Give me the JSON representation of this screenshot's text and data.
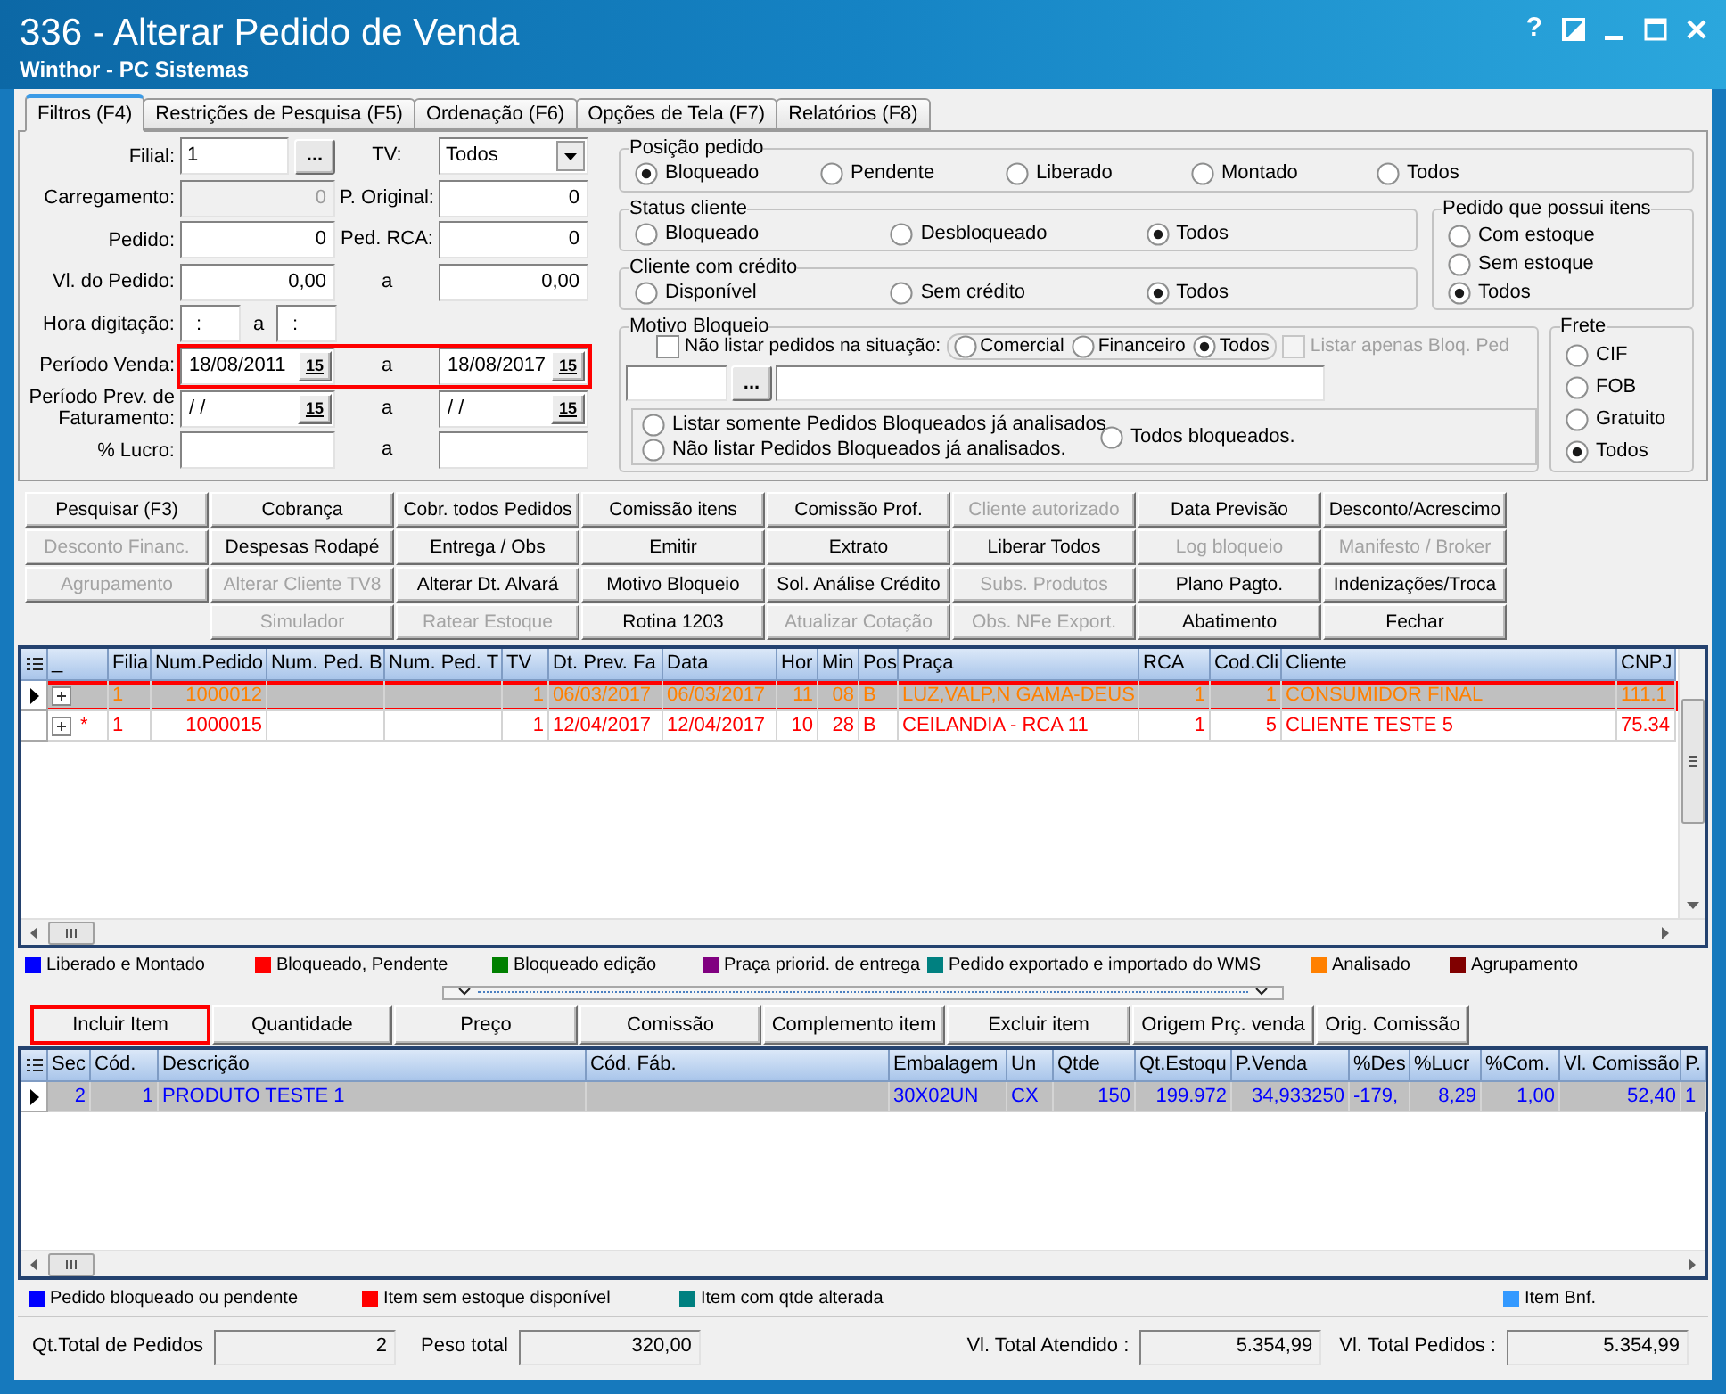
{
  "window": {
    "title": "336 - Alterar Pedido de Venda",
    "subtitle": "Winthor - PC Sistemas",
    "help": "?"
  },
  "tabs": [
    {
      "label": "Filtros (F4)",
      "selected": true
    },
    {
      "label": "Restrições de Pesquisa (F5)",
      "selected": false
    },
    {
      "label": "Ordenação (F6)",
      "selected": false
    },
    {
      "label": "Opções de Tela (F7)",
      "selected": false
    },
    {
      "label": "Relatórios (F8)",
      "selected": false
    }
  ],
  "filters": {
    "rows": [
      {
        "highlighted": false,
        "left": {
          "label": "Filial:",
          "kind": "browse",
          "value": "1",
          "button": "...",
          "disabled": false
        },
        "right": {
          "label": "TV:",
          "kind": "select",
          "value": "Todos",
          "disabled": false
        }
      },
      {
        "highlighted": false,
        "left": {
          "label": "Carregamento:",
          "kind": "number",
          "value": "0",
          "disabled": true
        },
        "right": {
          "label": "P. Original:",
          "kind": "number",
          "value": "0",
          "disabled": false
        }
      },
      {
        "highlighted": false,
        "left": {
          "label": "Pedido:",
          "kind": "number",
          "value": "0",
          "disabled": false
        },
        "right": {
          "label": "Ped. RCA:",
          "kind": "number",
          "value": "0",
          "disabled": false
        }
      },
      {
        "highlighted": false,
        "left": {
          "label": "Vl. do Pedido:",
          "kind": "number",
          "value": "0,00",
          "disabled": false
        },
        "right": {
          "label": "a",
          "kind": "number",
          "value": "0,00",
          "disabled": false
        }
      },
      {
        "highlighted": false,
        "left": {
          "label": "Hora digitação:",
          "kind": "time",
          "value": ":",
          "disabled": false
        },
        "right": {
          "label": "a",
          "kind": "time",
          "value": ":",
          "disabled": false
        }
      },
      {
        "highlighted": true,
        "left": {
          "label": "Período Venda:",
          "kind": "date",
          "value": "18/08/2011",
          "calendar": "15",
          "disabled": false
        },
        "right": {
          "label": "a",
          "kind": "date",
          "value": "18/08/2017",
          "calendar": "15",
          "disabled": false
        }
      },
      {
        "highlighted": false,
        "left": {
          "label": "Período Prev. de Faturamento:",
          "kind": "date",
          "value": "/ /",
          "calendar": "15",
          "disabled": false
        },
        "right": {
          "label": "a",
          "kind": "date",
          "value": "/ /",
          "calendar": "15",
          "disabled": false
        }
      },
      {
        "highlighted": false,
        "left": {
          "label": "% Lucro:",
          "kind": "number",
          "disabled": false
        },
        "right": {
          "label": "a",
          "kind": "number",
          "disabled": false
        }
      }
    ]
  },
  "position_group": {
    "title": "Posição pedido",
    "options": [
      {
        "label": "Bloqueado",
        "selected": true
      },
      {
        "label": "Pendente",
        "selected": false
      },
      {
        "label": "Liberado",
        "selected": false
      },
      {
        "label": "Montado",
        "selected": false
      },
      {
        "label": "Todos",
        "selected": false
      }
    ]
  },
  "client_status": {
    "title": "Status cliente",
    "options": [
      {
        "label": "Bloqueado",
        "selected": false
      },
      {
        "label": "Desbloqueado",
        "selected": false
      },
      {
        "label": "Todos",
        "selected": true
      }
    ]
  },
  "client_credit": {
    "title": "Cliente com crédito",
    "options": [
      {
        "label": "Disponível",
        "selected": false
      },
      {
        "label": "Sem crédito",
        "selected": false
      },
      {
        "label": "Todos",
        "selected": true
      }
    ]
  },
  "stock_items": {
    "title": "Pedido que possui itens",
    "options": [
      {
        "label": "Com estoque",
        "selected": false
      },
      {
        "label": "Sem estoque",
        "selected": false
      },
      {
        "label": "Todos",
        "selected": true
      }
    ]
  },
  "block_reason": {
    "title": "Motivo Bloqueio",
    "exclude_check": {
      "label": "Não listar pedidos na situação:",
      "checked": false,
      "disabled": false
    },
    "situations": [
      {
        "label": "Comercial",
        "selected": false
      },
      {
        "label": "Financeiro",
        "selected": false
      },
      {
        "label": "Todos",
        "selected": true
      }
    ],
    "only_blocked_check": {
      "label": "Listar apenas Bloq. Ped",
      "checked": false,
      "disabled": true
    },
    "code_button": "...",
    "analysis": [
      {
        "label": "Listar somente Pedidos Bloqueados já analisados.",
        "selected": false
      },
      {
        "label": "Não listar Pedidos Bloqueados já analisados.",
        "selected": false
      },
      {
        "label": "Todos bloqueados.",
        "selected": false
      }
    ]
  },
  "freight": {
    "title": "Frete",
    "options": [
      {
        "label": "CIF",
        "selected": false
      },
      {
        "label": "FOB",
        "selected": false
      },
      {
        "label": "Gratuito",
        "selected": false
      },
      {
        "label": "Todos",
        "selected": true
      }
    ]
  },
  "action_buttons": [
    [
      {
        "label": "Pesquisar (F3)",
        "disabled": false
      },
      {
        "label": "Desconto Financ.",
        "disabled": true
      },
      {
        "label": "Agrupamento",
        "disabled": true
      }
    ],
    [
      {
        "label": "Cobrança",
        "disabled": false
      },
      {
        "label": "Despesas Rodapé",
        "disabled": false
      },
      {
        "label": "Alterar Cliente TV8",
        "disabled": true
      },
      {
        "label": "Simulador",
        "disabled": true
      }
    ],
    [
      {
        "label": "Cobr. todos Pedidos",
        "disabled": false
      },
      {
        "label": "Entrega / Obs",
        "disabled": false
      },
      {
        "label": "Alterar Dt. Alvará",
        "disabled": false
      },
      {
        "label": "Ratear Estoque",
        "disabled": true
      }
    ],
    [
      {
        "label": "Comissão itens",
        "disabled": false
      },
      {
        "label": "Emitir",
        "disabled": false
      },
      {
        "label": "Motivo Bloqueio",
        "disabled": false
      },
      {
        "label": "Rotina 1203",
        "disabled": false
      }
    ],
    [
      {
        "label": "Comissão Prof.",
        "disabled": false
      },
      {
        "label": "Extrato",
        "disabled": false
      },
      {
        "label": "Sol. Análise Crédito",
        "disabled": false
      },
      {
        "label": "Atualizar Cotação",
        "disabled": true
      }
    ],
    [
      {
        "label": "Cliente autorizado",
        "disabled": true
      },
      {
        "label": "Liberar Todos",
        "disabled": false
      },
      {
        "label": "Subs. Produtos",
        "disabled": true
      },
      {
        "label": "Obs. NFe Export.",
        "disabled": true
      }
    ],
    [
      {
        "label": "Data Previsão",
        "disabled": false
      },
      {
        "label": "Log bloqueio",
        "disabled": true
      },
      {
        "label": "Plano Pagto.",
        "disabled": false
      },
      {
        "label": "Abatimento",
        "disabled": false
      }
    ],
    [
      {
        "label": "Desconto/Acrescimo",
        "disabled": false
      },
      {
        "label": "Manifesto / Broker",
        "disabled": true
      },
      {
        "label": "Indenizações/Troca",
        "disabled": false
      },
      {
        "label": "Fechar",
        "disabled": false
      }
    ]
  ],
  "orders_grid": {
    "columns": [
      "_",
      "Filia",
      "Num.Pedido",
      "Num. Ped. B",
      "Num. Ped. T",
      "TV",
      "Dt. Prev. Fa",
      "Data",
      "Hor",
      "Min",
      "Pos",
      "Praça",
      "RCA",
      "Cod.Cli",
      "Cliente",
      "CNPJ"
    ],
    "rows": [
      {
        "selected": true,
        "highlighted": true,
        "expanded": false,
        "color": "#ff8000",
        "cells": [
          "",
          "1",
          "1000012",
          "",
          "",
          "1",
          "06/03/2017",
          "06/03/2017",
          "11",
          "08",
          "B",
          "LUZ,VALP,N GAMA-DEUS",
          "1",
          "1",
          "CONSUMIDOR FINAL",
          "111.1"
        ]
      },
      {
        "selected": false,
        "highlighted": false,
        "expanded": false,
        "color": "#ff0000",
        "cells": [
          "*",
          "1",
          "1000015",
          "",
          "",
          "1",
          "12/04/2017",
          "12/04/2017",
          "10",
          "28",
          "B",
          "CEILANDIA - RCA 11",
          "1",
          "5",
          "CLIENTE TESTE 5",
          "75.34"
        ]
      }
    ]
  },
  "orders_legend": [
    {
      "label": "Liberado e Montado",
      "color": "#0000ff"
    },
    {
      "label": "Bloqueado, Pendente",
      "color": "#ff0000"
    },
    {
      "label": "Bloqueado edição",
      "color": "#008000"
    },
    {
      "label": "Praça priorid. de entrega",
      "color": "#800080"
    },
    {
      "label": "Pedido exportado e importado do WMS",
      "color": "#008080"
    },
    {
      "label": "Analisado",
      "color": "#ff8000"
    },
    {
      "label": "Agrupamento",
      "color": "#800000"
    }
  ],
  "item_buttons": [
    {
      "label": "Incluir Item",
      "highlighted": true
    },
    {
      "label": "Quantidade",
      "highlighted": false
    },
    {
      "label": "Preço",
      "highlighted": false
    },
    {
      "label": "Comissão",
      "highlighted": false
    },
    {
      "label": "Complemento item",
      "highlighted": false
    },
    {
      "label": "Excluir item",
      "highlighted": false
    },
    {
      "label": "Origem Prç. venda",
      "highlighted": false
    },
    {
      "label": "Orig. Comissão",
      "highlighted": false
    }
  ],
  "items_grid": {
    "columns": [
      "Sec",
      "Cód.",
      "Descrição",
      "Cód. Fáb.",
      "Embalagem",
      "Un",
      "Qtde",
      "Qt.Estoqu",
      "P.Venda",
      "%Des",
      "%Lucr",
      "%Com.",
      "Vl. Comissão",
      "P."
    ],
    "rows": [
      {
        "selected": true,
        "color": "#0000ff",
        "cells": [
          "2",
          "1",
          "PRODUTO TESTE 1",
          "",
          "30X02UN",
          "CX",
          "150",
          "199.972",
          "34,933250",
          "-179,",
          "8,29",
          "1,00",
          "52,40",
          "1"
        ]
      }
    ]
  },
  "items_legend": [
    {
      "label": "Pedido bloqueado ou pendente",
      "color": "#0000ff"
    },
    {
      "label": "Item sem estoque disponível",
      "color": "#ff0000"
    },
    {
      "label": "Item com qtde alterada",
      "color": "#008080"
    },
    {
      "label": "Item Bnf.",
      "color": "#3399ff"
    }
  ],
  "totals": [
    {
      "label": "Qt.Total de Pedidos",
      "value": "2"
    },
    {
      "label": "Peso total",
      "value": "320,00"
    },
    {
      "label": "Vl. Total Atendido :",
      "value": "5.354,99"
    },
    {
      "label": "Vl. Total Pedidos :",
      "value": "5.354,99"
    }
  ]
}
